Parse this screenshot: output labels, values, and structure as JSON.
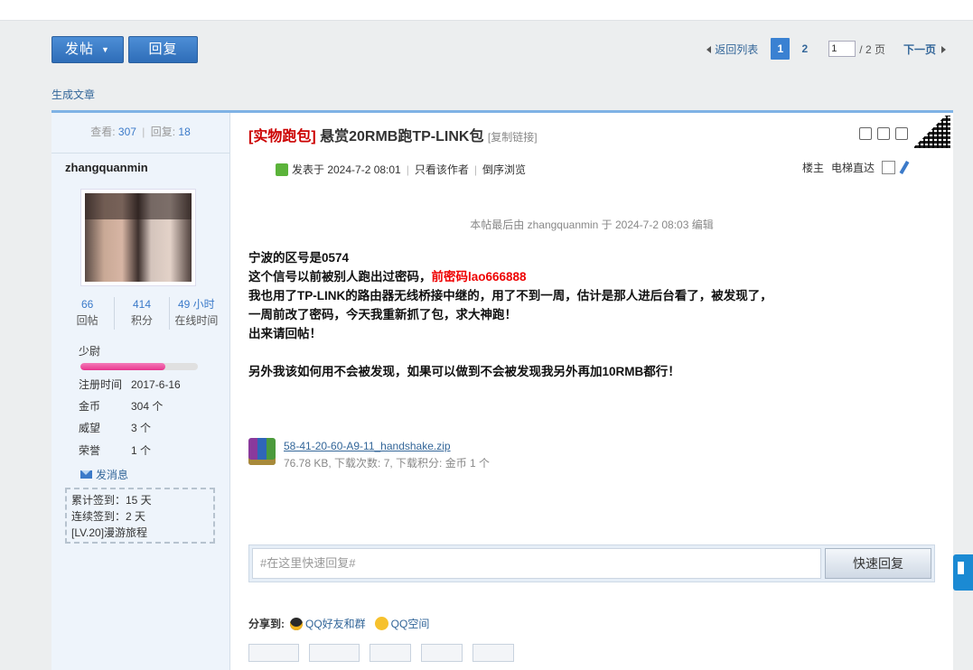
{
  "toolbar": {
    "post_label": "发帖",
    "post_caret": "▼",
    "reply_label": "回复"
  },
  "pager": {
    "back_label": "返回列表",
    "pages": [
      "1",
      "2"
    ],
    "current_page": "1",
    "input_value": "1",
    "total_text": "/ 2 页",
    "next_label": "下一页"
  },
  "generate_article": "生成文章",
  "stats": {
    "views_label": "查看:",
    "views": "307",
    "sep": "|",
    "replies_label": "回复:",
    "replies": "18"
  },
  "author": {
    "name": "zhangquanmin",
    "stats": [
      {
        "value": "66",
        "label": "回帖"
      },
      {
        "value": "414",
        "label": "积分"
      },
      {
        "value": "49 小时",
        "label": "在线时间"
      }
    ],
    "rank": "少尉",
    "rank_progress": 0.72,
    "details": [
      {
        "k": "注册时间",
        "v": "2017-6-16"
      },
      {
        "k": "金币",
        "v": "304 个"
      },
      {
        "k": "威望",
        "v": "3 个"
      },
      {
        "k": "荣誉",
        "v": "1 个"
      }
    ],
    "send_message": "发消息",
    "signin": [
      "累计签到：15 天",
      "连续签到：2 天",
      "[LV.20]漫游旅程"
    ]
  },
  "post": {
    "category": "[实物跑包]",
    "title": "悬赏20RMB跑TP-LINK包",
    "copy_link": "[复制链接]",
    "posted_at": "发表于 2024-7-2 08:01",
    "only_author": "只看该作者",
    "reverse_view": "倒序浏览",
    "floor": "楼主",
    "elevator": "电梯直达",
    "edit_note": "本帖最后由 zhangquanmin 于 2024-7-2 08:03 编辑",
    "lines": [
      "宁波的区号是0574",
      "这个信号以前被别人跑出过密码，",
      "我也用了TP-LINK的路由器无线桥接中继的，用了不到一周，估计是那人进后台看了，被发现了，",
      "一周前改了密码，今天我重新抓了包，求大神跑！",
      "出来请回帖！",
      "另外我该如何用不会被发现，如果可以做到不会被发现我另外再加10RMB都行！"
    ],
    "red_text": "前密码lao666888",
    "attachment": {
      "name": "58-41-20-60-A9-11_handshake.zip",
      "info": "76.78 KB, 下载次数: 7, 下载积分: 金币 1 个"
    }
  },
  "reply": {
    "placeholder": "#在这里快速回复#",
    "button": "快速回复"
  },
  "share": {
    "label": "分享到:",
    "qq": "QQ好友和群",
    "qzone": "QQ空间"
  },
  "colors": {
    "accent": "#3a81d2",
    "title_red": "#cc0000",
    "link": "#336699"
  }
}
